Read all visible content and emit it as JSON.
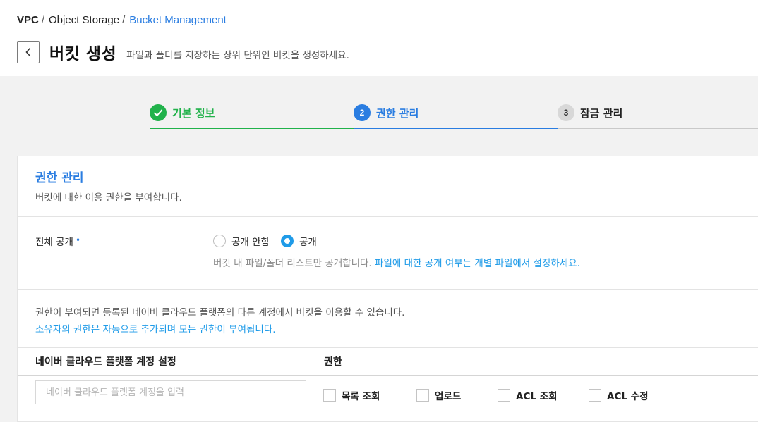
{
  "breadcrumb": [
    "VPC",
    "Object Storage",
    "Bucket Management"
  ],
  "breadcrumb_separator": "/",
  "header": {
    "title": "버킷 생성",
    "description": "파일과 폴더를 저장하는 상위 단위인 버킷을 생성하세요.",
    "back_icon": "chevron-left-icon"
  },
  "steps": [
    {
      "label": "기본 정보",
      "number": "",
      "status": "completed",
      "icon": "check-icon"
    },
    {
      "label": "권한 관리",
      "number": "2",
      "status": "active"
    },
    {
      "label": "잠금 관리",
      "number": "3",
      "status": "pending"
    }
  ],
  "section": {
    "title": "권한 관리",
    "description": "버킷에 대한 이용 권한을 부여합니다."
  },
  "public_access": {
    "label": "전체 공개",
    "required_marker": "•",
    "options": [
      "공개 안함",
      "공개"
    ],
    "selected": "공개",
    "help_text": "버킷 내 파일/폴더 리스트만 공개합니다.",
    "help_link": "파일에 대한 공개 여부는 개별 파일에서 설정하세요."
  },
  "permissions": {
    "notice": "권한이 부여되면 등록된 네이버 클라우드 플랫폼의 다른 계정에서 버킷을 이용할 수 있습니다.",
    "notice_highlight": "소유자의 권한은 자동으로 추가되며 모든 권한이 부여됩니다.",
    "col_account": "네이버 클라우드 플랫폼 계정 설정",
    "col_permission": "권한",
    "account_placeholder": "네이버 클라우드 플랫폼 계정을 입력",
    "account_value": "",
    "checkboxes": [
      {
        "label": "목록 조회",
        "checked": false
      },
      {
        "label": "업로드",
        "checked": false
      },
      {
        "label": "ACL 조회",
        "checked": false
      },
      {
        "label": "ACL 수정",
        "checked": false
      }
    ]
  },
  "colors": {
    "accent": "#2a7de1",
    "link": "#1f9be8",
    "completed": "#21b24b",
    "background": "#f2f2f2"
  }
}
